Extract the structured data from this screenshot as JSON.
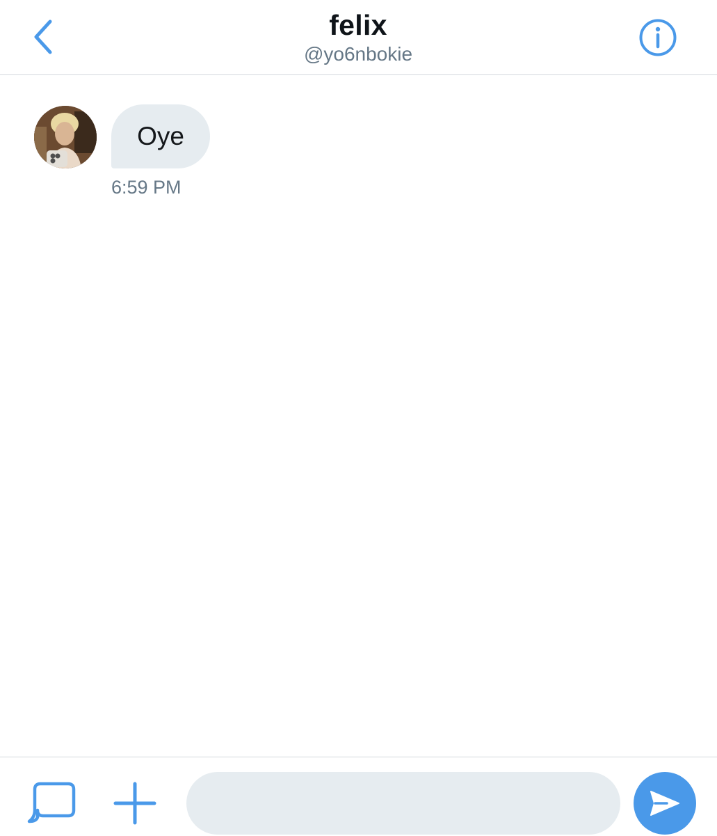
{
  "header": {
    "back_icon": "chevron-left-icon",
    "title": "felix",
    "handle": "@yo6nbokie",
    "info_icon": "info-circle-icon"
  },
  "conversation": {
    "messages": [
      {
        "sender": "felix",
        "avatar": "profile-photo",
        "text": "Oye",
        "time": "6:59 PM"
      }
    ]
  },
  "composer": {
    "gif_icon": "speech-bubble-icon",
    "add_icon": "plus-icon",
    "input_value": "",
    "input_placeholder": "",
    "send_icon": "send-arrow-icon"
  },
  "colors": {
    "accent": "#4a99e9",
    "bubble": "#e6ecf0",
    "secondary_text": "#657786",
    "divider": "#d3d8dc"
  }
}
